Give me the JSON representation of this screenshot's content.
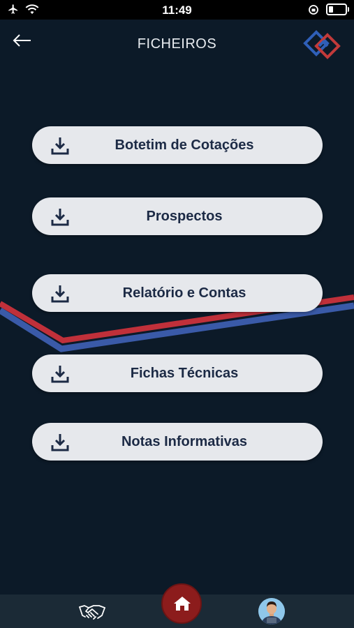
{
  "status_bar": {
    "time": "11:49"
  },
  "header": {
    "title": "FICHEIROS"
  },
  "files": [
    {
      "label": "Botetim de Cotações"
    },
    {
      "label": "Prospectos"
    },
    {
      "label": "Relatório e Contas"
    },
    {
      "label": "Fichas Técnicas"
    },
    {
      "label": "Notas Informativas"
    }
  ],
  "colors": {
    "background": "#0c1a28",
    "button_bg": "#e6e8ec",
    "button_text": "#1c2a45",
    "accent_red": "#c0303a",
    "accent_blue": "#3a5aa8",
    "home_button": "#8c1c1c"
  },
  "icons": {
    "back": "arrow-left-icon",
    "file_action": "download-icon",
    "nav_left": "handshake-icon",
    "nav_center": "home-icon",
    "nav_right": "avatar"
  }
}
